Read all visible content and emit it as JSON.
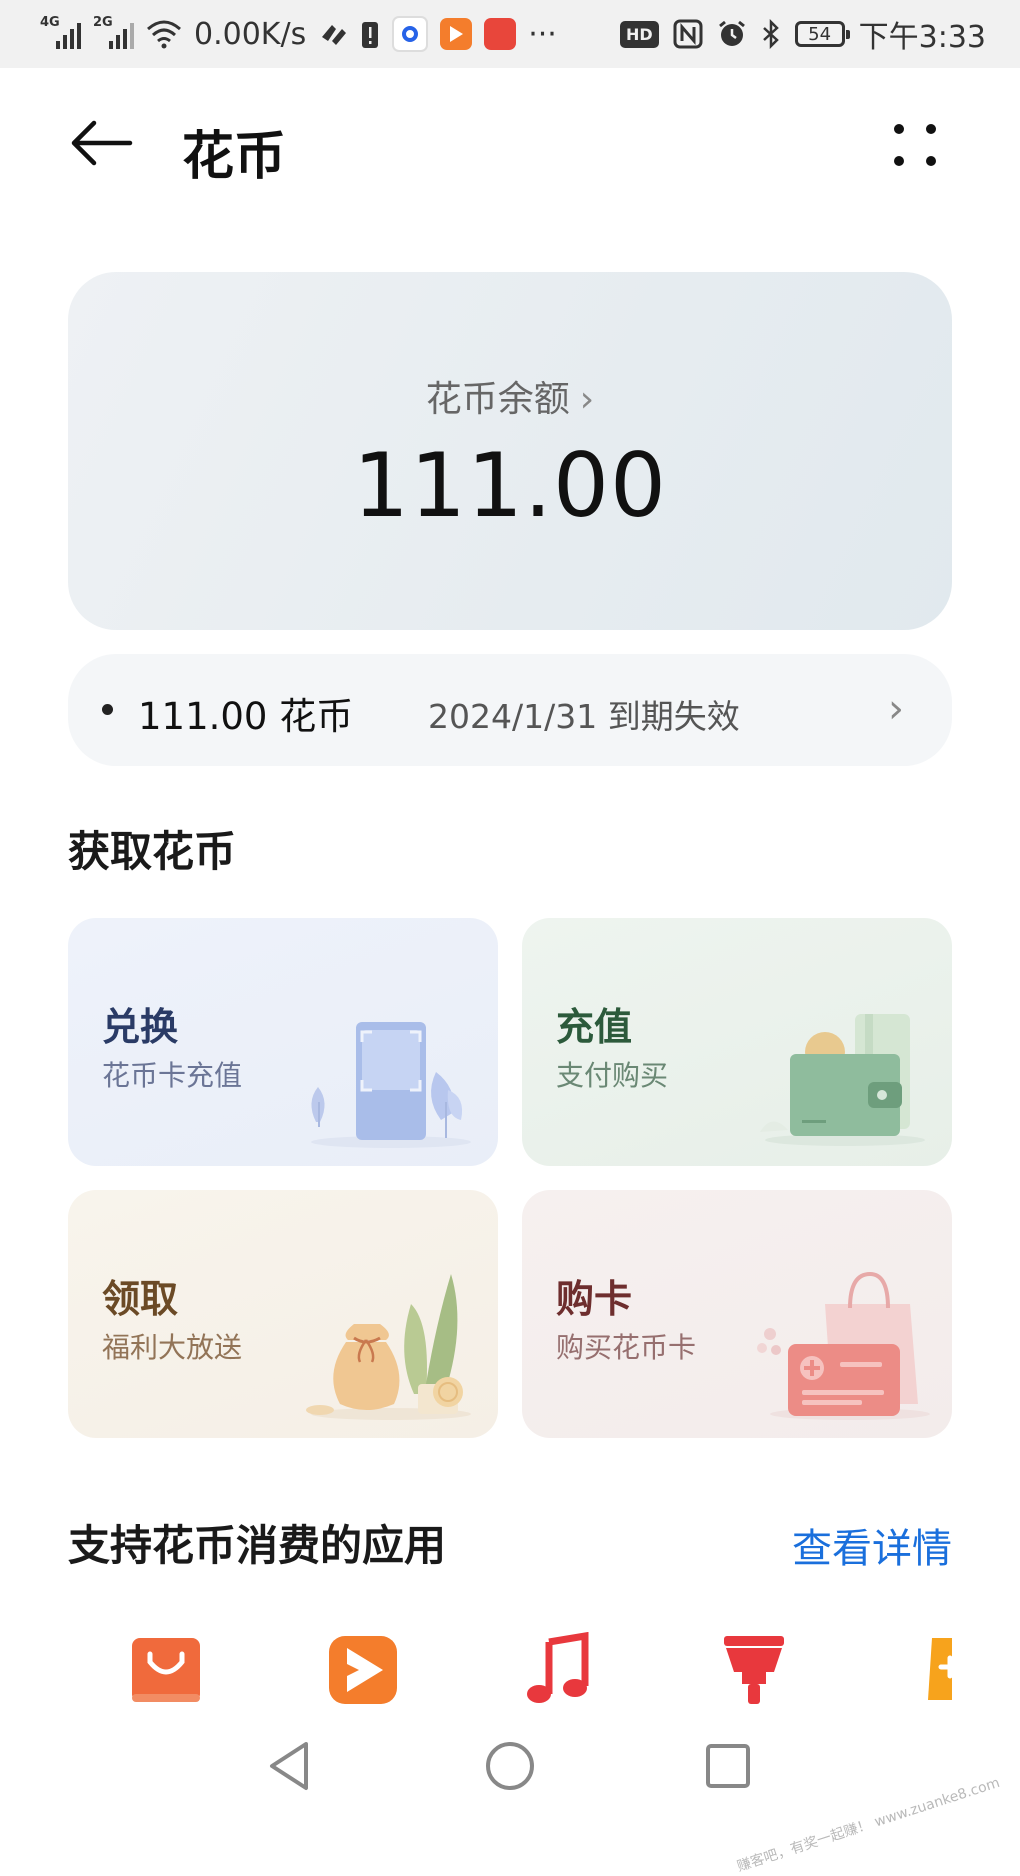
{
  "status_bar": {
    "net1": "4G",
    "net2": "2G",
    "speed": "0.00K/s",
    "hd": "HD",
    "battery": "54",
    "time": "下午3:33",
    "more": "···"
  },
  "header": {
    "title": "花币"
  },
  "balance": {
    "label": "花币余额",
    "amount": "111.00"
  },
  "expiry": {
    "text": "111.00 花币",
    "date_text": "2024/1/31 到期失效"
  },
  "earn": {
    "title": "获取花币",
    "tiles": [
      {
        "title": "兑换",
        "subtitle": "花币卡充值"
      },
      {
        "title": "充值",
        "subtitle": "支付购买"
      },
      {
        "title": "领取",
        "subtitle": "福利大放送"
      },
      {
        "title": "购卡",
        "subtitle": "购买花币卡"
      }
    ]
  },
  "apps": {
    "title": "支持花币消费的应用",
    "details_link": "查看详情",
    "icons": [
      "shopping-bag-icon",
      "video-play-icon",
      "music-note-icon",
      "theme-brush-icon",
      "game-icon"
    ]
  },
  "watermark": "赚客吧，有奖一起赚！ www.zuanke8.com",
  "colors": {
    "accent_blue": "#1a6fdc",
    "app_orange": "#f06a3c",
    "music_red": "#e8383d"
  }
}
